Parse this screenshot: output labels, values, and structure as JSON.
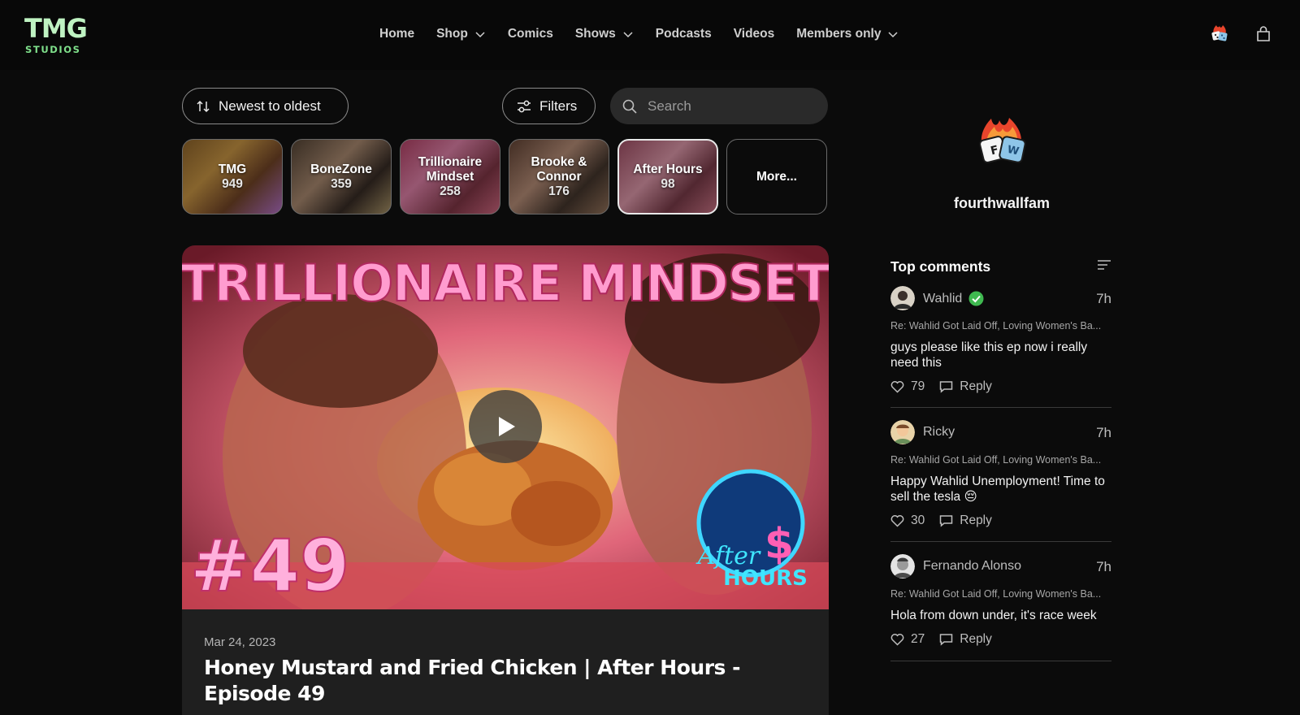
{
  "logo": {
    "primary": "TMG",
    "secondary": "STUDIOS"
  },
  "nav": {
    "items": [
      {
        "label": "Home",
        "dropdown": false
      },
      {
        "label": "Shop",
        "dropdown": true
      },
      {
        "label": "Comics",
        "dropdown": false
      },
      {
        "label": "Shows",
        "dropdown": true
      },
      {
        "label": "Podcasts",
        "dropdown": false
      },
      {
        "label": "Videos",
        "dropdown": false
      },
      {
        "label": "Members only",
        "dropdown": true
      }
    ]
  },
  "toolbar": {
    "sort_label": "Newest to oldest",
    "filters_label": "Filters",
    "search_placeholder": "Search"
  },
  "shows": [
    {
      "name": "TMG",
      "count": "949"
    },
    {
      "name": "BoneZone",
      "count": "359"
    },
    {
      "name": "Trillionaire Mindset",
      "count": "258"
    },
    {
      "name": "Brooke & Connor",
      "count": "176"
    },
    {
      "name": "After Hours",
      "count": "98",
      "active": true
    },
    {
      "name": "More..."
    }
  ],
  "featured": {
    "thumbnail_text": {
      "title": "TRILLIONAIRE MINDSET",
      "episode": "#49",
      "badge_line1": "After",
      "badge_line2": "HOURS",
      "badge_symbol": "$"
    },
    "date": "Mar 24, 2023",
    "title": "Honey Mustard and Fried Chicken | After Hours - Episode 49"
  },
  "profile": {
    "name": "fourthwallfam"
  },
  "comments_section": {
    "title": "Top comments",
    "comments": [
      {
        "author": "Wahlid",
        "verified": true,
        "time": "7h",
        "re": "Re: Wahlid Got Laid Off, Loving Women's Ba...",
        "text": "guys please like this ep now i really need this",
        "likes": "79",
        "reply_label": "Reply"
      },
      {
        "author": "Ricky",
        "verified": false,
        "time": "7h",
        "re": "Re: Wahlid Got Laid Off, Loving Women's Ba...",
        "text": "Happy Wahlid Unemployment! Time to sell the tesla 😔",
        "likes": "30",
        "reply_label": "Reply"
      },
      {
        "author": "Fernando Alonso",
        "verified": false,
        "time": "7h",
        "re": "Re: Wahlid Got Laid Off, Loving Women's Ba...",
        "text": "Hola from down under, it's race week",
        "likes": "27",
        "reply_label": "Reply"
      }
    ]
  },
  "colors": {
    "accent_green": "#7fe08b",
    "logo_light": "#bff3c2",
    "background": "#0b0b0b",
    "card": "#1f1f1f",
    "verified": "#3fb950"
  }
}
